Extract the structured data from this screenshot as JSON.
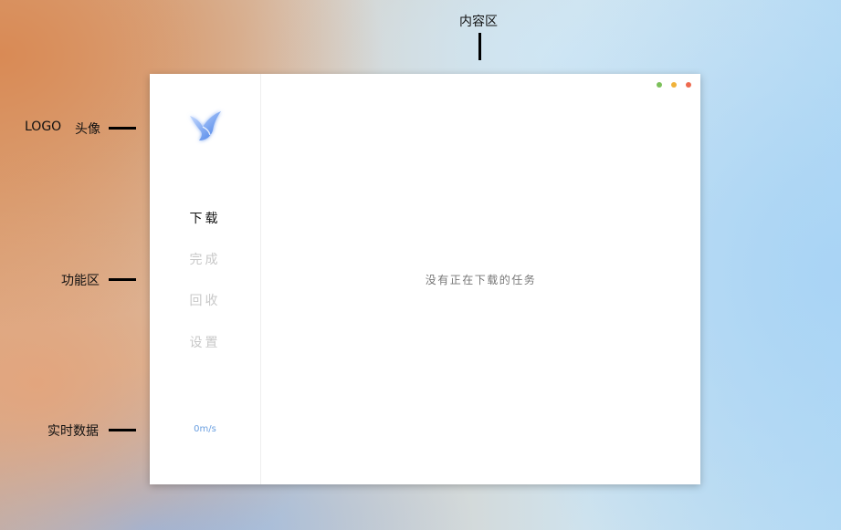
{
  "annotations": {
    "content_area": "内容区",
    "logo": "LOGO",
    "avatar": "头像",
    "function_area": "功能区",
    "realtime_data": "实时数据"
  },
  "sidebar": {
    "logo_icon": "bird-logo-icon",
    "items": [
      {
        "label": "下载",
        "active": true
      },
      {
        "label": "完成",
        "active": false
      },
      {
        "label": "回收",
        "active": false
      },
      {
        "label": "设置",
        "active": false
      }
    ],
    "speed": "0m/s"
  },
  "window_controls": {
    "colors": [
      "#7cc05a",
      "#f0b23a",
      "#ee6a4f"
    ]
  },
  "content": {
    "empty_message": "没有正在下载的任务"
  }
}
